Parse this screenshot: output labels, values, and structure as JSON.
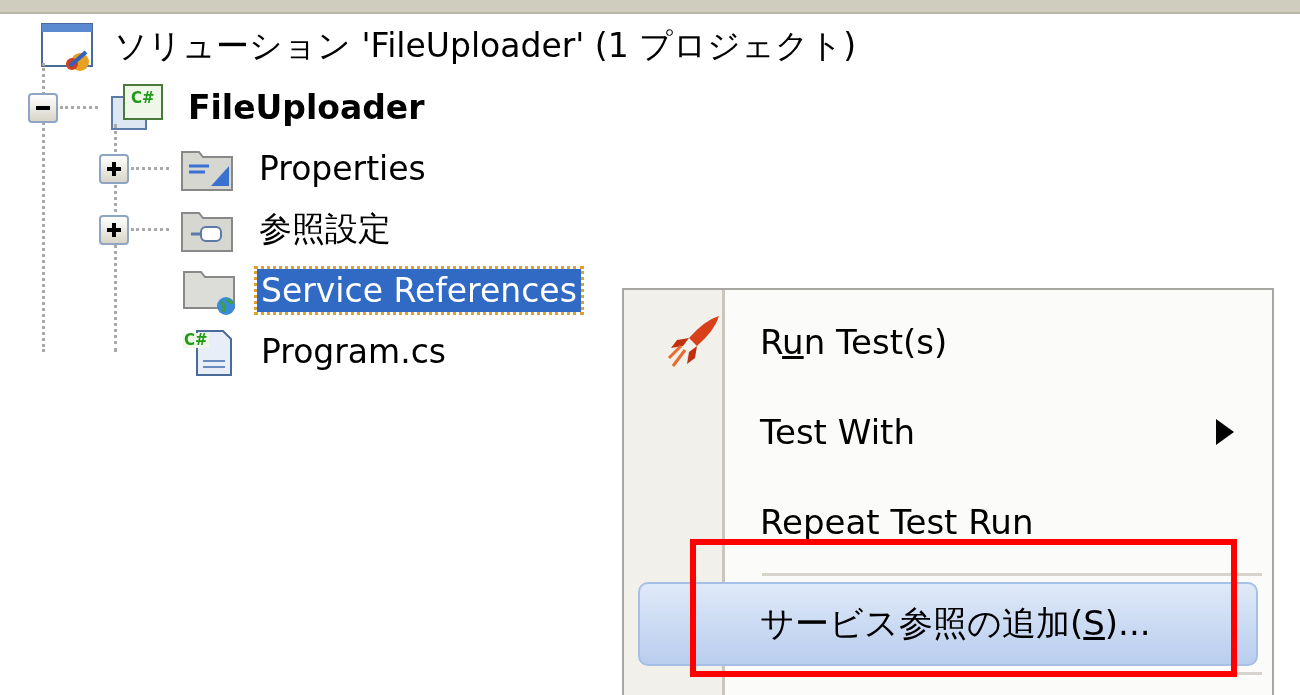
{
  "solution_explorer": {
    "root": {
      "label": "ソリューション 'FileUploader' (1 プロジェクト)",
      "kind": "solution",
      "selected": false,
      "children": [
        {
          "label": "FileUploader",
          "kind": "project",
          "badge": "C#",
          "expanded": true,
          "selected": false,
          "children": [
            {
              "label": "Properties",
              "kind": "properties",
              "expanded": false,
              "selected": false
            },
            {
              "label": "参照設定",
              "kind": "references",
              "expanded": false,
              "selected": false
            },
            {
              "label": "Service References",
              "kind": "service-folder",
              "selected": true
            },
            {
              "label": "Program.cs",
              "kind": "csfile",
              "badge": "C#",
              "selected": false
            }
          ]
        }
      ]
    }
  },
  "context_menu": {
    "items": [
      {
        "kind": "command",
        "before": "R",
        "key": "u",
        "after": "n Test(s)",
        "icon": true,
        "submenu": false,
        "selected": false
      },
      {
        "kind": "command",
        "before": "Test With",
        "icon": false,
        "submenu": true,
        "selected": false
      },
      {
        "kind": "command",
        "before": "Repeat Test Run",
        "icon": false,
        "submenu": false,
        "selected": false
      },
      {
        "kind": "separator"
      },
      {
        "kind": "command",
        "before": "サービス参照の追加(",
        "key": "S",
        "after": ")...",
        "icon": false,
        "submenu": false,
        "selected": true
      },
      {
        "kind": "separator"
      }
    ],
    "annotation": {
      "kind": "frame"
    }
  }
}
